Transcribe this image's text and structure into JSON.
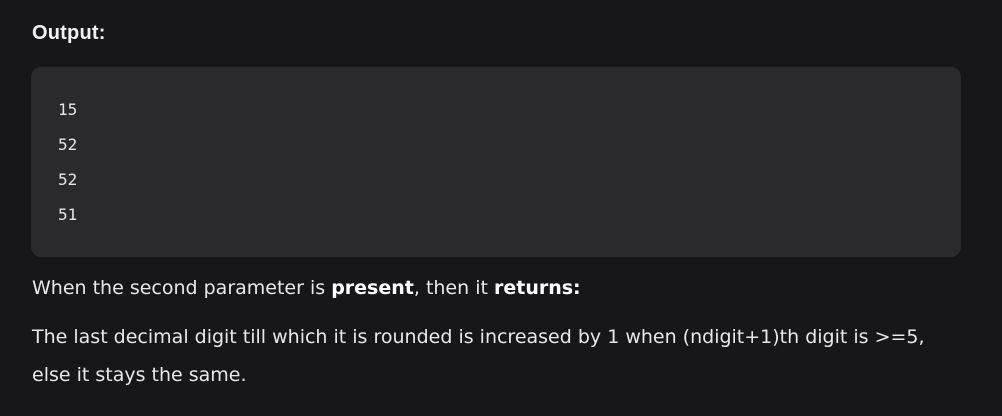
{
  "heading": "Output:",
  "output_lines": [
    "15",
    "52",
    "52",
    "51"
  ],
  "paragraph1": {
    "part1": "When the second parameter is ",
    "bold1": "present",
    "part2": ", then it ",
    "bold2": "returns:"
  },
  "paragraph2": {
    "line1": "The last decimal digit till which it is rounded is increased by 1 when (ndigit+1)th digit is >=5,",
    "line2": "else it stays the same."
  }
}
